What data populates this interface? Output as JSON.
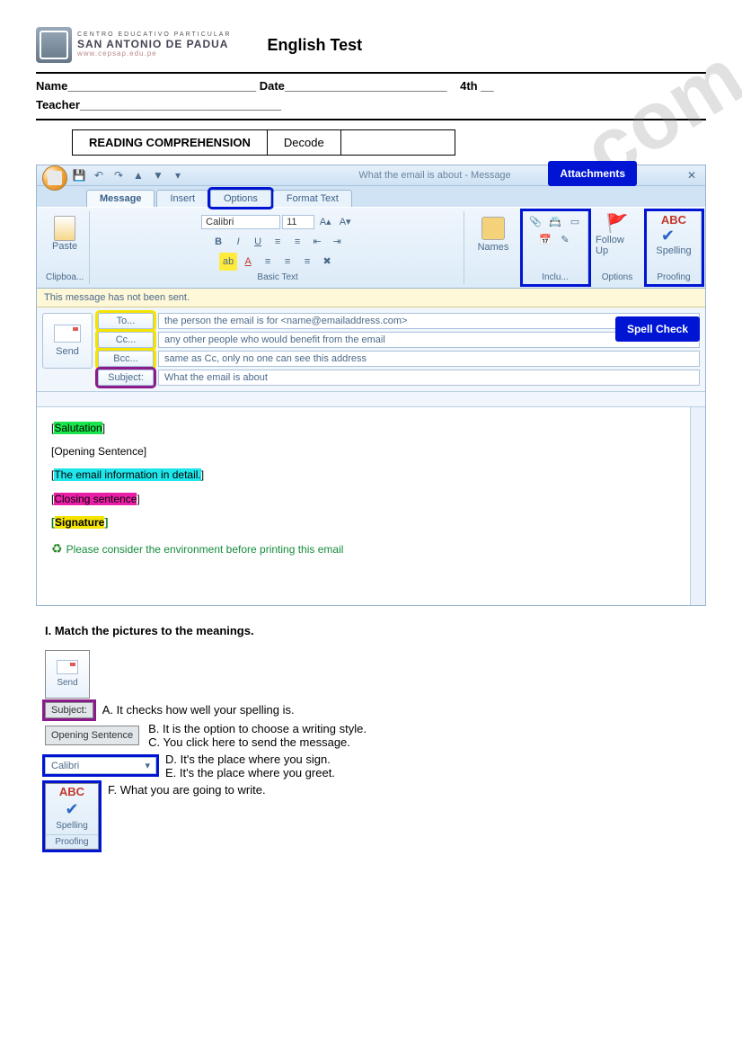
{
  "header": {
    "logo_line1": "CENTRO EDUCATIVO PARTICULAR",
    "logo_line2": "SAN ANTONIO DE PADUA",
    "logo_line3": "www.cepsap.edu.pe",
    "title": "English Test"
  },
  "form": {
    "name_label": "Name_____________________________",
    "date_label": "Date_________________________",
    "grade_label": "4th __",
    "teacher_label": "Teacher_______________________________"
  },
  "box": {
    "cell1": "READING COMPREHENSION",
    "cell2": "Decode",
    "cell3": ""
  },
  "app": {
    "title_text": "What the email is about  -  Message",
    "tabs": {
      "message": "Message",
      "insert": "Insert",
      "options": "Options",
      "format": "Format Text"
    },
    "paste": "Paste",
    "clipboard_label": "Clipboa...",
    "font_name": "Calibri",
    "font_size": "11",
    "basic_text_label": "Basic Text",
    "names": "Names",
    "include": "Inclu...",
    "followup": "Follow Up",
    "options_label": "Options",
    "spelling": "Spelling",
    "proofing": "Proofing",
    "abc": "ABC",
    "callout_attach": "Attachments",
    "callout_spell": "Spell Check",
    "msgbar": "This message has not been sent.",
    "to_btn": "To...",
    "cc_btn": "Cc...",
    "bcc_btn": "Bcc...",
    "subject_btn": "Subject:",
    "to_val": "the person the email is for <name@emailaddress.com>",
    "cc_val": "any other people who would benefit from the email",
    "bcc_val": "same as Cc, only no one can see this address",
    "subject_val": "What the email is about",
    "send": "Send",
    "body": {
      "salutation": "Salutation",
      "opening": "[Opening Sentence]",
      "detail": "The email information in detail.",
      "closing": "Closing sentence",
      "signature": "Signature",
      "env": "Please consider the environment before printing this email"
    }
  },
  "exercise": {
    "heading": "I.    Match the pictures to the meanings.",
    "send": "Send",
    "subject": "Subject:",
    "opening": "Opening Sentence",
    "font": "Calibri",
    "spelling": "Spelling",
    "proofing": "Proofing",
    "abc": "ABC",
    "opts": {
      "a": "A. It checks how well your spelling is.",
      "b": "B. It is the  option to choose a writing style.",
      "c": "C. You click here to send the  message.",
      "d": "D. It's the place where you sign.",
      "e": "E. It's the place where you greet.",
      "f": "F. What you are going to write."
    }
  },
  "watermark": "ESLprintables.com"
}
